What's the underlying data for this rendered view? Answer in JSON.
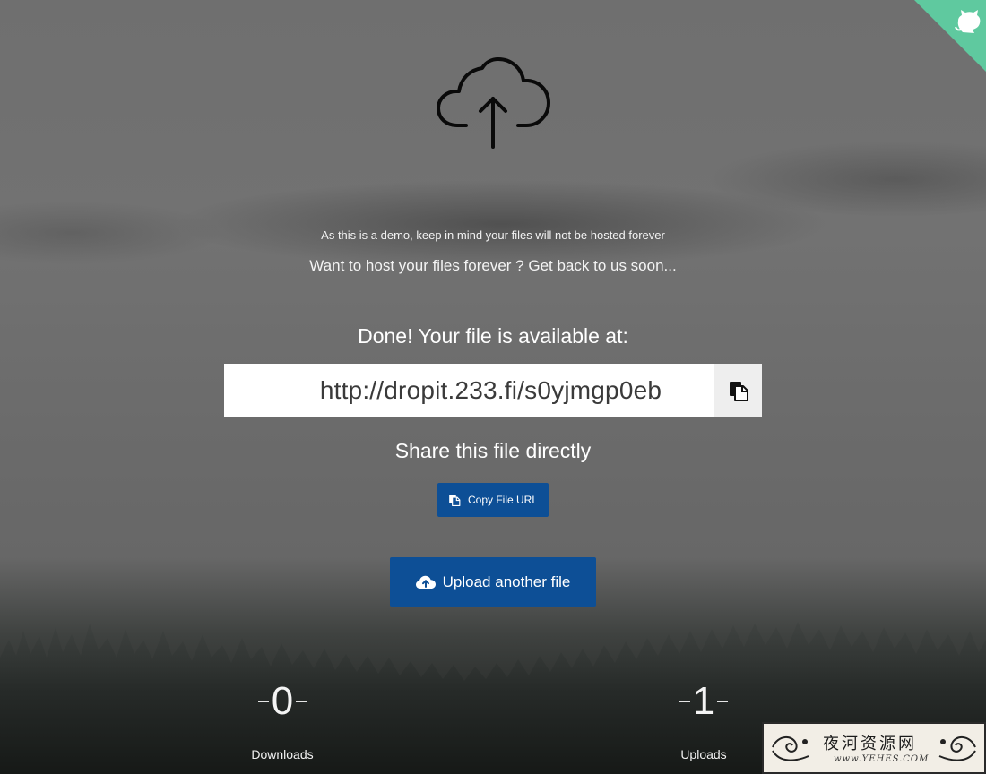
{
  "notes": {
    "demo": "As this is a demo, keep in mind your files will not be hosted forever",
    "host": "Want to host your files forever ? Get back to us soon..."
  },
  "result": {
    "heading": "Done! Your file is available at:",
    "url": "http://dropit.233.fi/s0yjmgp0eb"
  },
  "share": {
    "heading": "Share this file directly",
    "copy_button": "Copy File URL"
  },
  "upload": {
    "button": "Upload another file"
  },
  "stats": {
    "downloads_value": "0",
    "downloads_label": "Downloads",
    "uploads_value": "1",
    "uploads_label": "Uploads"
  },
  "watermark": {
    "title": "夜河资源网",
    "url": "www.YEHES.COM"
  },
  "colors": {
    "button_blue": "#0d4f96",
    "corner_green": "#5fc99f"
  },
  "icons": {
    "hero": "cloud-upload-icon",
    "copy": "copy-icon",
    "upload": "cloud-upload-solid-icon",
    "corner": "github-octocat-icon"
  }
}
